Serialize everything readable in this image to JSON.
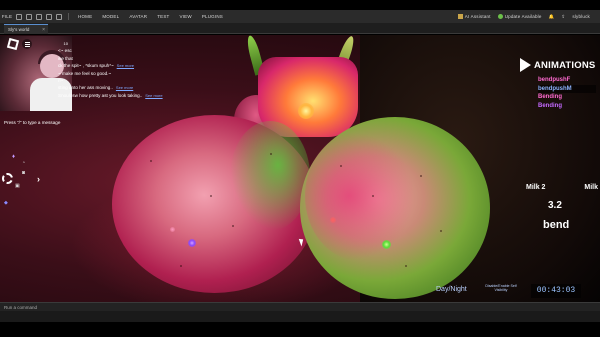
{
  "menubar": {
    "file": "FILE",
    "items": [
      "HOME",
      "MODEL",
      "AVATAR",
      "TEST",
      "VIEW",
      "PLUGINS"
    ],
    "ai_assistant": "AI Assistant",
    "update": "Update Available",
    "user": "slybluck"
  },
  "tab": {
    "title": "Sly's world",
    "close": "×"
  },
  "chat": {
    "badge": "10",
    "lines": [
      {
        "text": "<~ esc"
      },
      {
        "text": "ike that"
      },
      {
        "text": "ck the spit~ , *skum spuh*~",
        "more": "See more"
      },
      {
        "text": "~ make me feel so good.~"
      },
      {
        "text": "n~"
      },
      {
        "text": "sting onto her ass moving..",
        "more": "See more"
      },
      {
        "text": "Snouldsw how pretty ast you look taking..",
        "more": "See more"
      }
    ],
    "hint": "Press \"/\" to type a message"
  },
  "animations": {
    "title": "ANIMATIONS",
    "items": [
      {
        "label": "bendpushF",
        "color": "#ff6ad0"
      },
      {
        "label": "bendpushM",
        "color": "#8fb4ff",
        "selected": true
      },
      {
        "label": "Bending",
        "color": "#ff6ad0"
      },
      {
        "label": "Bending",
        "color": "#c46aff"
      }
    ]
  },
  "stats": {
    "left_label": "Milk 2",
    "right_label": "Milk",
    "value": "3.2",
    "state": "bend"
  },
  "controls": {
    "daynight": "Day/Night",
    "disable": "Disable/Enable Self Visibility",
    "timer": "00:43:03"
  },
  "command": {
    "placeholder": "Run a command"
  }
}
